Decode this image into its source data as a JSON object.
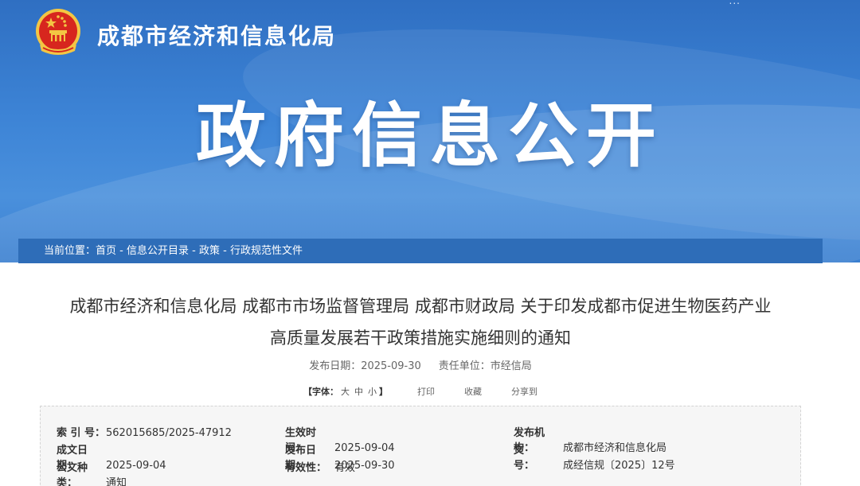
{
  "header": {
    "top_links": "...",
    "site_name": "成都市经济和信息化局",
    "banner_title": "政府信息公开"
  },
  "breadcrumb": {
    "prefix": "当前位置：",
    "items": [
      "首页",
      "信息公开目录",
      "政策",
      "行政规范性文件"
    ],
    "separator": " - "
  },
  "document": {
    "title_line1": "成都市经济和信息化局 成都市市场监督管理局 成都市财政局 关于印发成都市促进生物医药产业",
    "title_line2": "高质量发展若干政策措施实施细则的通知",
    "publish_date_label": "发布日期：",
    "publish_date": "2025-09-30",
    "unit_label": "责任单位：",
    "unit": "市经信局"
  },
  "tools": {
    "font_label_open": "【字体：",
    "font_sizes": [
      "大",
      "中",
      "小"
    ],
    "font_label_close": "】",
    "print": "打印",
    "favorite": "收藏",
    "share": "分享到"
  },
  "info": {
    "index_no_label": "索 引 号：",
    "index_no": "562015685/2025-47912",
    "effective_label": "生效时间：",
    "effective": "2025-09-04",
    "issuer_label": "发布机构：",
    "issuer": "成都市经济和信息化局",
    "written_label": "成文日期：",
    "written": "2025-09-04",
    "published_label": "发布日期：",
    "published": "2025-09-30",
    "docno_label": "文　　号：",
    "docno": "成经信规〔2025〕12号",
    "type_label": "公文种类：",
    "type": "通知",
    "validity_label": "有效性：",
    "validity": "有效"
  },
  "colors": {
    "banner": "#3d84d6",
    "crumb_bar": "#2e6db8",
    "emblem_red": "#d7261e",
    "emblem_gold": "#f3c643"
  }
}
